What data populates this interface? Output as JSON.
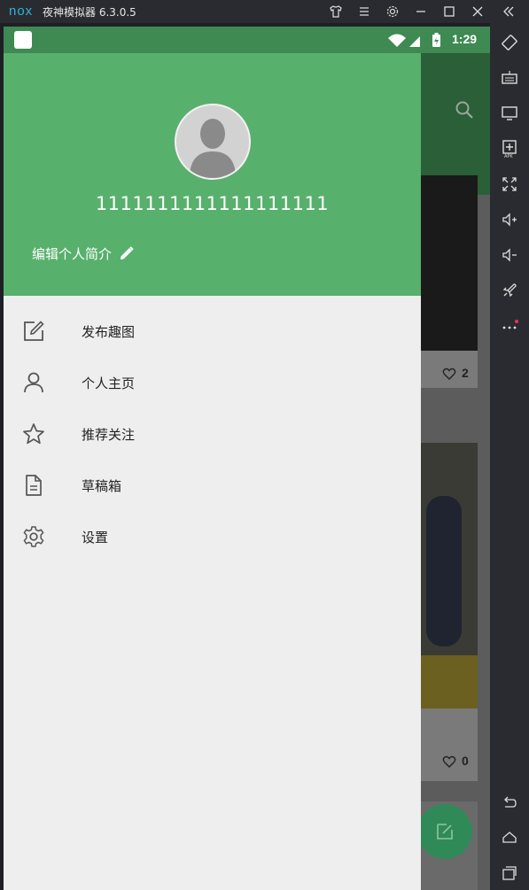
{
  "window": {
    "logo": "nox",
    "title": "夜神模拟器 6.3.0.5"
  },
  "statusbar": {
    "time": "1:29"
  },
  "drawer": {
    "username": "1111111111111111111",
    "bio_label": "编辑个人简介",
    "menu": [
      {
        "label": "发布趣图",
        "icon": "edit-square-icon"
      },
      {
        "label": "个人主页",
        "icon": "person-icon"
      },
      {
        "label": "推荐关注",
        "icon": "star-icon"
      },
      {
        "label": "草稿箱",
        "icon": "document-icon"
      },
      {
        "label": "设置",
        "icon": "gear-icon"
      }
    ]
  },
  "background_feed": {
    "likes": [
      "2",
      "0"
    ]
  },
  "colors": {
    "header_green": "#58b06d",
    "drawer_bg": "#eeeeee",
    "status_green": "#3f8a52"
  }
}
